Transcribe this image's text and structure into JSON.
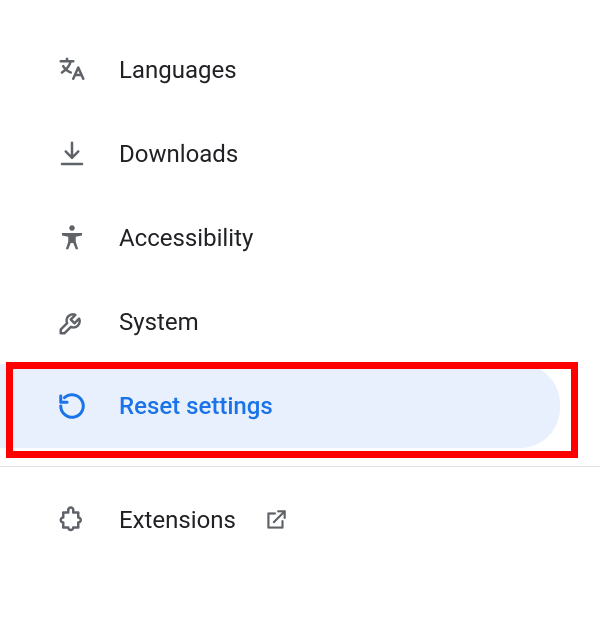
{
  "sidebar": {
    "items": [
      {
        "label": "Languages",
        "icon": "translate-icon",
        "selected": false
      },
      {
        "label": "Downloads",
        "icon": "download-icon",
        "selected": false
      },
      {
        "label": "Accessibility",
        "icon": "accessibility-icon",
        "selected": false
      },
      {
        "label": "System",
        "icon": "wrench-icon",
        "selected": false
      },
      {
        "label": "Reset settings",
        "icon": "reset-icon",
        "selected": true
      }
    ],
    "extensions": {
      "label": "Extensions",
      "icon": "extension-icon",
      "external": true
    }
  },
  "highlight": {
    "target": "sidebar-item-reset-settings",
    "color": "#ff0000"
  },
  "colors": {
    "accent": "#1a73e8",
    "selected_bg": "#e8f0fe",
    "text": "#202124",
    "icon": "#5f6368"
  }
}
